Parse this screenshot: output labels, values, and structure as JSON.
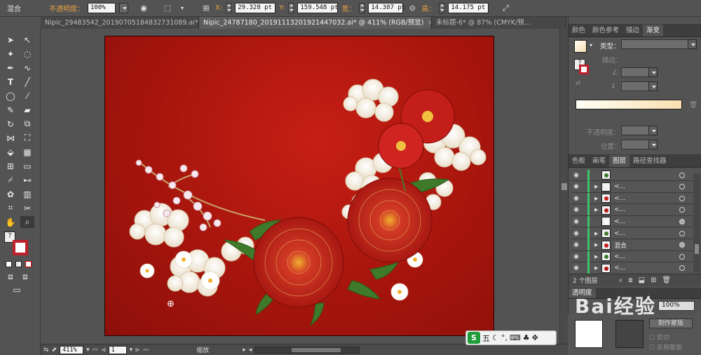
{
  "control_bar": {
    "mode_label": "混合",
    "opacity_label": "不透明度：",
    "opacity_value": "100%",
    "x_label": "X:",
    "x_value": "29.328 pt",
    "y_label": "Y:",
    "y_value": "159.548 pt",
    "width_label": "宽：",
    "width_value": "14.387 pt",
    "height_label": "高：",
    "height_value": "14.175 pt"
  },
  "tabs": [
    {
      "label": "Nipic_29483542_20190705184832731089.ai* @ ..."
    },
    {
      "label": "Nipic_24787180_20191113201921447032.ai* @ 411% (RGB/预览)"
    },
    {
      "label": "未标题-6* @ 87% (CMYK/预..."
    }
  ],
  "status_bar": {
    "zoom": "411%",
    "page": "1",
    "tool_name": "缩放"
  },
  "ime": {
    "logo": "S",
    "mode": "五"
  },
  "panels": {
    "top_tabs": [
      "颜色",
      "颜色参考",
      "描边",
      "渐变"
    ],
    "gradient": {
      "type_label": "类型：",
      "stroke_label": "描边：",
      "opacity_label": "不透明度：",
      "position_label": "位置："
    },
    "layer_tabs": [
      "色板",
      "画笔",
      "图层",
      "路径查找器"
    ],
    "layers": [
      {
        "name": "",
        "tri": "",
        "thumb": "leaf"
      },
      {
        "name": "<...",
        "tri": "▶",
        "thumb": "plain"
      },
      {
        "name": "<...",
        "tri": "▶",
        "thumb": "flower"
      },
      {
        "name": "<...",
        "tri": "▶",
        "thumb": "red"
      },
      {
        "name": "<...",
        "tri": "",
        "thumb": "white"
      },
      {
        "name": "<...",
        "tri": "▶",
        "thumb": "leaf"
      },
      {
        "name": "混合",
        "tri": "▶",
        "thumb": "flower"
      },
      {
        "name": "<...",
        "tri": "▶",
        "thumb": "leaf"
      },
      {
        "name": "<...",
        "tri": "▶",
        "thumb": "red"
      }
    ],
    "layer_count": "2 个图层",
    "transparency": {
      "tab_label": "透明度",
      "opacity_value": "100%",
      "make_mask_label": "制作蒙版",
      "clip_label": "剪切",
      "invert_label": "反相蒙版"
    }
  },
  "watermark": "Bai经验"
}
